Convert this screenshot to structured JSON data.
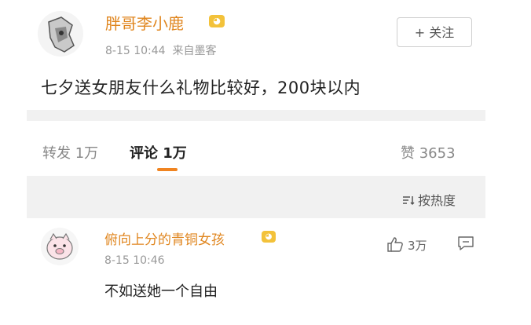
{
  "post": {
    "username": "胖哥李小鹿",
    "time": "8-15 10:44",
    "source": "来自墨客",
    "follow_label": "+ 关注",
    "text": "七夕送女朋友什么礼物比较好，200块以内"
  },
  "actions": {
    "repost": "转发 1万",
    "comment": "评论 1万",
    "like": "赞 3653"
  },
  "sort_label": "按热度",
  "comment": {
    "username": "俯向上分的青铜女孩",
    "time": "8-15 10:46",
    "text": "不如送她一个自由",
    "likes": "3万"
  },
  "colors": {
    "username": "#e0861f",
    "tab_underline": "#f08421",
    "badge": "#f3c23a",
    "band": "#f1f1f1"
  },
  "icons": [
    "avatar-image",
    "vip-badge-icon",
    "sort-icon",
    "thumbs-up-icon",
    "reply-icon"
  ]
}
